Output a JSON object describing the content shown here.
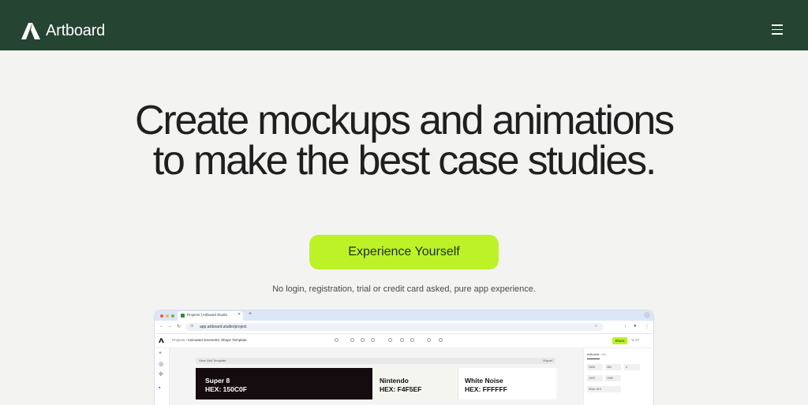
{
  "header": {
    "brand_name": "Artboard",
    "menu_icon": "hamburger-menu-icon",
    "background_color": "#254432"
  },
  "hero": {
    "title": "Create mockups and animations to make the best case studies.",
    "cta_label": "Experience Yourself",
    "cta_color": "#bdf227",
    "note": "No login, registration, trial or credit card asked, pure app experience."
  },
  "mockup": {
    "tab_title": "Projects | Artboard Studio",
    "url": "app.artboard.studio/project",
    "breadcrumb_root": "Projects",
    "breadcrumb_current": "Animated Geometric Shape Template",
    "share_label": "Share",
    "zoom": "% 47",
    "canvas_bar_left": "View Grid Template",
    "canvas_bar_right": "Export",
    "panel_title": "Artboard",
    "panel_tab": "Info",
    "panel_fields": [
      "2528",
      "384",
      "0",
      "1920",
      "1080",
      "Slide 16:9"
    ],
    "swatches": [
      {
        "name": "Super 8",
        "hex": "HEX: 150C0F",
        "bg": "#150c0f",
        "fg": "#ffffff"
      },
      {
        "name": "Nintendo",
        "hex": "HEX: F4F5EF",
        "bg": "#f4f5ef",
        "fg": "#111111"
      },
      {
        "name": "White Noise",
        "hex": "HEX: FFFFFF",
        "bg": "#ffffff",
        "fg": "#111111"
      }
    ]
  }
}
